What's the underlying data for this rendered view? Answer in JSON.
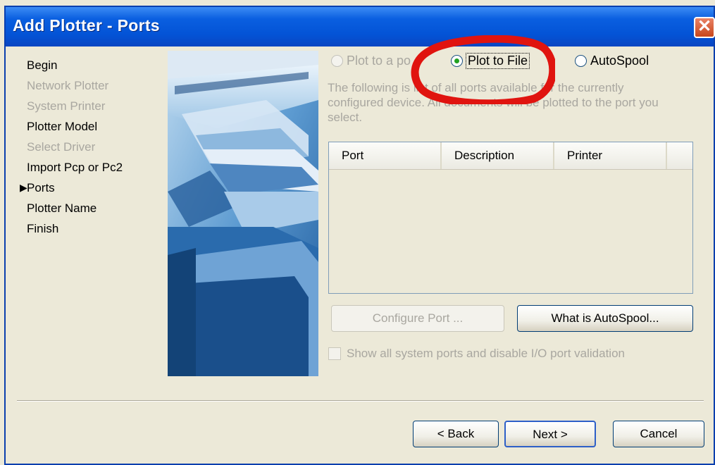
{
  "window": {
    "title": "Add Plotter - Ports",
    "close_icon": "close-icon"
  },
  "steps": [
    {
      "label": "Begin",
      "state": "normal"
    },
    {
      "label": "Network Plotter",
      "state": "disabled"
    },
    {
      "label": "System Printer",
      "state": "disabled"
    },
    {
      "label": "Plotter Model",
      "state": "normal"
    },
    {
      "label": "Select Driver",
      "state": "disabled"
    },
    {
      "label": "Import Pcp or Pc2",
      "state": "normal"
    },
    {
      "label": "Ports",
      "state": "current"
    },
    {
      "label": "Plotter Name",
      "state": "normal"
    },
    {
      "label": "Finish",
      "state": "normal"
    }
  ],
  "output": {
    "plot_to_port": "Plot to a po",
    "plot_to_file": "Plot to File",
    "autospool": "AutoSpool",
    "selected": "Plot to File"
  },
  "description": "The following is list of all ports available for the currently configured device. All documents will be plotted to the port you select.",
  "ports_table": {
    "columns": [
      "Port",
      "Description",
      "Printer"
    ],
    "rows": []
  },
  "buttons": {
    "configure_port": "Configure Port ...",
    "what_is_autospool": "What is AutoSpool...",
    "back": "< Back",
    "next": "Next >",
    "cancel": "Cancel"
  },
  "show_all_ports": {
    "label": "Show all system ports and disable I/O port validation",
    "checked": false
  },
  "colors": {
    "titlebar": "#0353d6",
    "annotation": "#e0140f",
    "dialog_bg": "#ece9d8"
  }
}
